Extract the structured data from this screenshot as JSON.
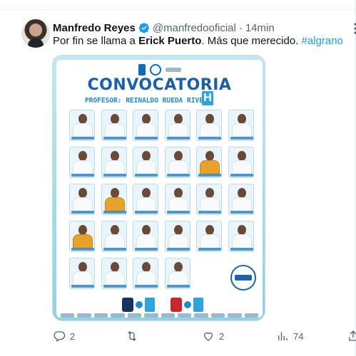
{
  "tweet": {
    "display_name": "Manfredo Reyes",
    "handle": "@manfredooficial",
    "separator": "·",
    "time": "14min",
    "text_prefix": "Por fin se llama a ",
    "text_bold": "Erick Puerto",
    "text_suffix": ". Más que merecido. ",
    "hashtag": "#algrano"
  },
  "media": {
    "poster_title": "CONVOCATORIA",
    "poster_subtitle": "PROFESOR: REINALDO RUEDA RIVERA",
    "h_letter": "H",
    "player_count": 28,
    "goalkeeper_positions": [
      10,
      13,
      18
    ]
  },
  "actions": {
    "reply_count": "2",
    "retweet_count": "",
    "like_count": "2",
    "views_count": "74"
  },
  "colors": {
    "accent": "#1d9bf0",
    "text": "#0f1419",
    "muted": "#536471",
    "poster_blue": "#1b5fa9"
  },
  "icons": [
    "verified-badge-icon",
    "more-icon",
    "reply-icon",
    "retweet-icon",
    "like-icon",
    "views-icon",
    "share-icon"
  ]
}
